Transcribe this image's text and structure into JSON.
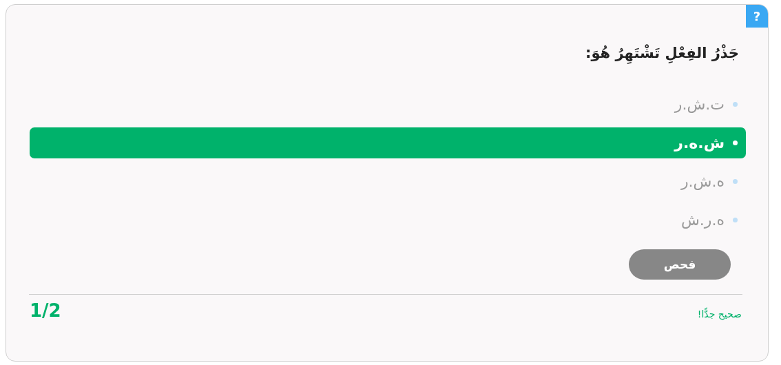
{
  "help_button": "?",
  "question": "جَذْرُ الفِعْلِ تَشْتَهِرُ هُوَ:",
  "options": [
    {
      "label": "ت.ش.ر",
      "selected": false
    },
    {
      "label": "ش.ه.ر",
      "selected": true
    },
    {
      "label": "ه.ش.ر",
      "selected": false
    },
    {
      "label": "ه.ر.ش",
      "selected": false
    }
  ],
  "check_button": "فحص",
  "feedback": "صحيح جدًّا!",
  "score": "1/2"
}
